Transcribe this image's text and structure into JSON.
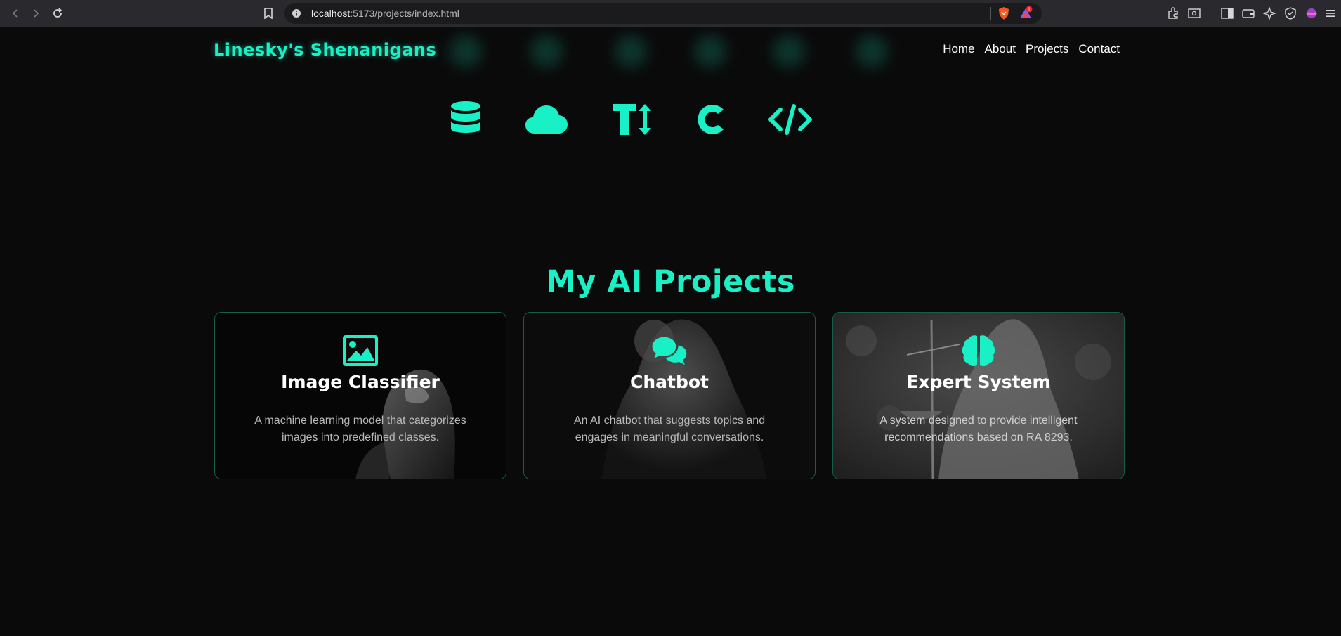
{
  "browser": {
    "url_host": "localhost",
    "url_path": ":5173/projects/index.html",
    "notification_count": "1"
  },
  "site": {
    "logo": "Linesky's Shenanigans",
    "nav": [
      "Home",
      "About",
      "Projects",
      "Contact"
    ],
    "tech_icons": [
      "database-icon",
      "cloud-icon",
      "text-height-icon",
      "c-language-icon",
      "code-icon"
    ],
    "section_title": "My AI Projects",
    "accent_color": "#19f0c6",
    "projects": [
      {
        "icon": "image-icon",
        "title": "Image Classifier",
        "description": "A machine learning model that categorizes images into predefined classes."
      },
      {
        "icon": "chat-bubbles-icon",
        "title": "Chatbot",
        "description": "An AI chatbot that suggests topics and engages in meaningful conversations."
      },
      {
        "icon": "brain-icon",
        "title": "Expert System",
        "description": "A system designed to provide intelligent recommendations based on RA 8293."
      }
    ]
  }
}
